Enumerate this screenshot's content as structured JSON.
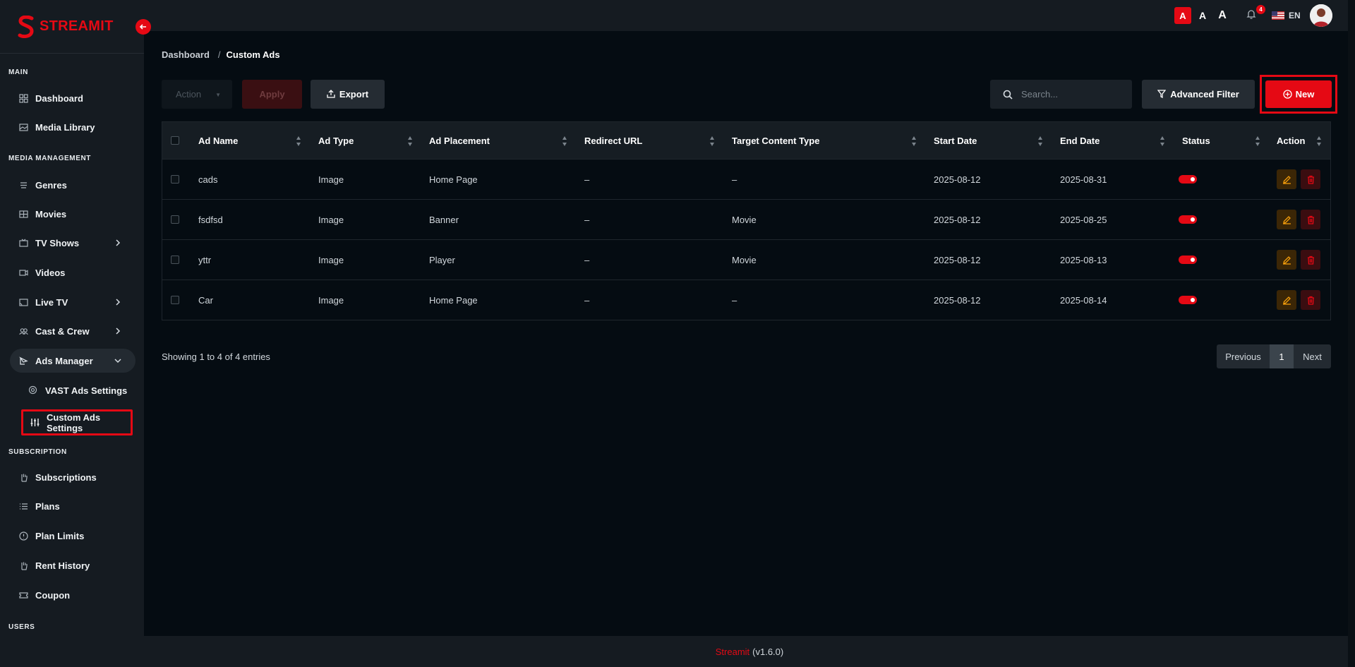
{
  "brand": {
    "name": "STREAMIT",
    "color": "#e50914"
  },
  "sidebar": {
    "sections": {
      "main": "MAIN",
      "media": "MEDIA MANAGEMENT",
      "subscription": "SUBSCRIPTION",
      "users": "USERS"
    },
    "items": {
      "dashboard": "Dashboard",
      "media_library": "Media Library",
      "genres": "Genres",
      "movies": "Movies",
      "tv_shows": "TV Shows",
      "videos": "Videos",
      "live_tv": "Live TV",
      "cast_crew": "Cast & Crew",
      "ads_manager": "Ads Manager",
      "vast_ads": "VAST Ads Settings",
      "custom_ads": "Custom Ads Settings",
      "subscriptions": "Subscriptions",
      "plans": "Plans",
      "plan_limits": "Plan Limits",
      "rent_history": "Rent History",
      "coupon": "Coupon"
    }
  },
  "topbar": {
    "font_sizes": [
      "A",
      "A",
      "A"
    ],
    "notification_count": "4",
    "language": "EN"
  },
  "breadcrumb": {
    "root": "Dashboard",
    "sep": "/",
    "current": "Custom Ads"
  },
  "toolbar": {
    "action_placeholder": "Action",
    "apply": "Apply",
    "export": "Export",
    "search_placeholder": "Search...",
    "advanced_filter": "Advanced Filter",
    "new": "New"
  },
  "table": {
    "headers": {
      "ad_name": "Ad Name",
      "ad_type": "Ad Type",
      "ad_placement": "Ad Placement",
      "redirect_url": "Redirect URL",
      "target_content": "Target Content Type",
      "start_date": "Start Date",
      "end_date": "End Date",
      "status": "Status",
      "action": "Action"
    },
    "rows": [
      {
        "ad_name": "cads",
        "ad_type": "Image",
        "ad_placement": "Home Page",
        "redirect_url": "–",
        "target_content": "–",
        "start_date": "2025-08-12",
        "end_date": "2025-08-31",
        "status": true
      },
      {
        "ad_name": "fsdfsd",
        "ad_type": "Image",
        "ad_placement": "Banner",
        "redirect_url": "–",
        "target_content": "Movie",
        "start_date": "2025-08-12",
        "end_date": "2025-08-25",
        "status": true
      },
      {
        "ad_name": "yttr",
        "ad_type": "Image",
        "ad_placement": "Player",
        "redirect_url": "–",
        "target_content": "Movie",
        "start_date": "2025-08-12",
        "end_date": "2025-08-13",
        "status": true
      },
      {
        "ad_name": "Car",
        "ad_type": "Image",
        "ad_placement": "Home Page",
        "redirect_url": "–",
        "target_content": "–",
        "start_date": "2025-08-12",
        "end_date": "2025-08-14",
        "status": true
      }
    ]
  },
  "pagination": {
    "showing": "Showing 1 to 4 of 4 entries",
    "previous": "Previous",
    "page": "1",
    "next": "Next"
  },
  "footer": {
    "brand": "Streamit",
    "version": "(v1.6.0)"
  }
}
